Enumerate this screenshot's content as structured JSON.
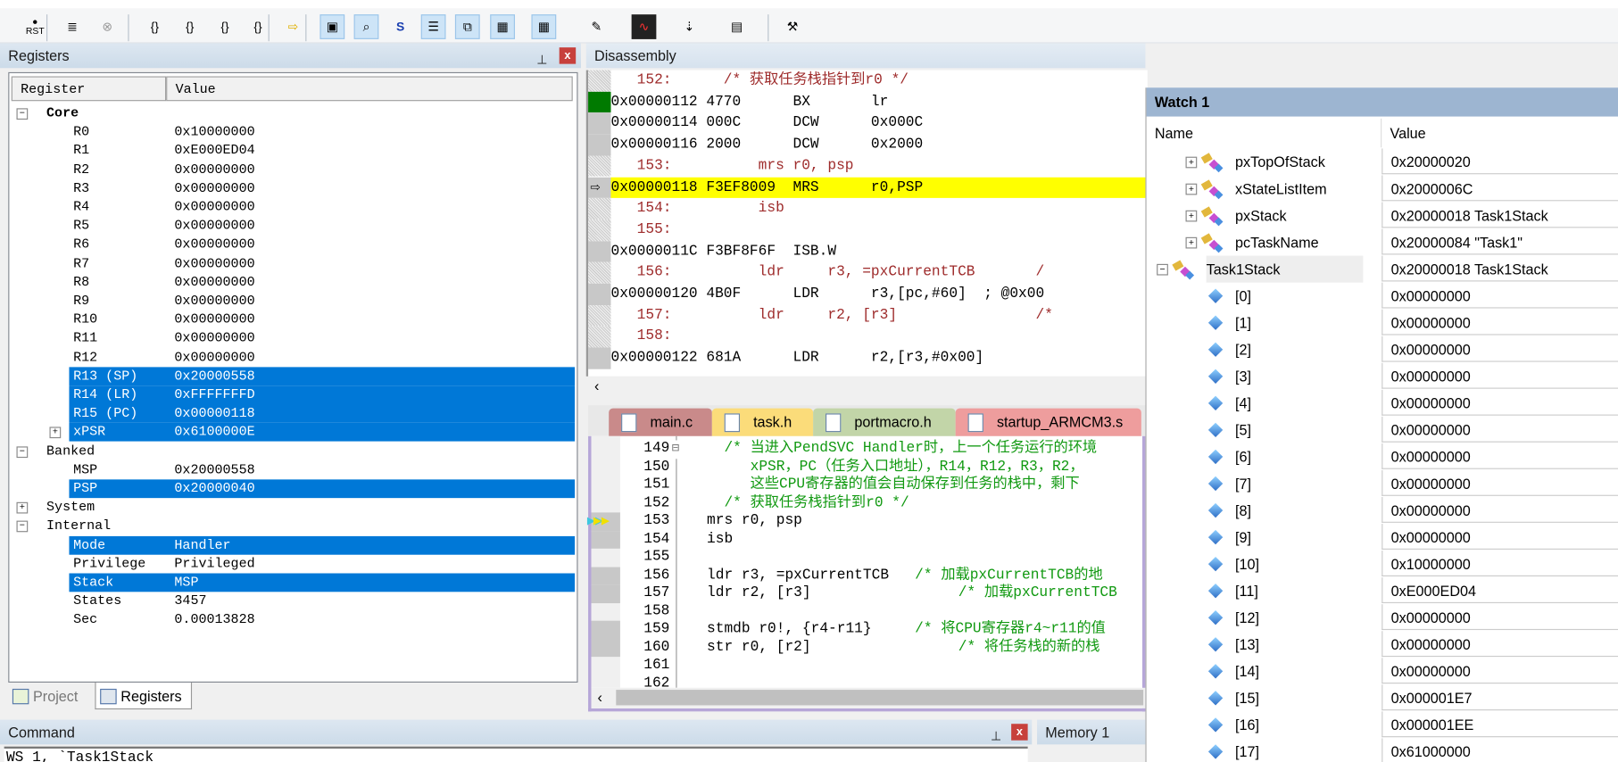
{
  "toolbar": {
    "buttons": [
      "reset-icon",
      "run-icon",
      "stop-icon",
      "step-into-icon",
      "step-over-icon",
      "step-out-icon",
      "run-to-cursor-icon",
      "show-next-statement-icon",
      "command-window-icon",
      "disassembly-window-icon",
      "symbols-window-icon",
      "registers-window-icon",
      "call-stack-icon",
      "watch-window-icon",
      "memory-window-icon",
      "serial-window-icon",
      "analysis-window-icon",
      "trace-icon",
      "system-viewer-icon",
      "toolbox-icon"
    ],
    "reset_label": "RST"
  },
  "registers": {
    "title": "Registers",
    "col_register": "Register",
    "col_value": "Value",
    "rows": [
      {
        "name": "Core",
        "value": "",
        "level": 0,
        "expander": "−",
        "bold": true
      },
      {
        "name": "R0",
        "value": "0x10000000",
        "level": 1
      },
      {
        "name": "R1",
        "value": "0xE000ED04",
        "level": 1
      },
      {
        "name": "R2",
        "value": "0x00000000",
        "level": 1
      },
      {
        "name": "R3",
        "value": "0x00000000",
        "level": 1
      },
      {
        "name": "R4",
        "value": "0x00000000",
        "level": 1
      },
      {
        "name": "R5",
        "value": "0x00000000",
        "level": 1
      },
      {
        "name": "R6",
        "value": "0x00000000",
        "level": 1
      },
      {
        "name": "R7",
        "value": "0x00000000",
        "level": 1
      },
      {
        "name": "R8",
        "value": "0x00000000",
        "level": 1
      },
      {
        "name": "R9",
        "value": "0x00000000",
        "level": 1
      },
      {
        "name": "R10",
        "value": "0x00000000",
        "level": 1
      },
      {
        "name": "R11",
        "value": "0x00000000",
        "level": 1
      },
      {
        "name": "R12",
        "value": "0x00000000",
        "level": 1
      },
      {
        "name": "R13 (SP)",
        "value": "0x20000558",
        "level": 1,
        "selected": true
      },
      {
        "name": "R14 (LR)",
        "value": "0xFFFFFFFD",
        "level": 1,
        "selected": true
      },
      {
        "name": "R15 (PC)",
        "value": "0x00000118",
        "level": 1,
        "selected": true
      },
      {
        "name": "xPSR",
        "value": "0x6100000E",
        "level": 1,
        "selected": true,
        "expander": "+"
      },
      {
        "name": "Banked",
        "value": "",
        "level": 0,
        "expander": "−"
      },
      {
        "name": "MSP",
        "value": "0x20000558",
        "level": 1
      },
      {
        "name": "PSP",
        "value": "0x20000040",
        "level": 1,
        "selected": true
      },
      {
        "name": "System",
        "value": "",
        "level": 0,
        "expander": "+"
      },
      {
        "name": "Internal",
        "value": "",
        "level": 0,
        "expander": "−"
      },
      {
        "name": "Mode",
        "value": "Handler",
        "level": 1,
        "selected": true
      },
      {
        "name": "Privilege",
        "value": "Privileged",
        "level": 1
      },
      {
        "name": "Stack",
        "value": "MSP",
        "level": 1,
        "selected": true
      },
      {
        "name": "States",
        "value": "3457",
        "level": 1
      },
      {
        "name": "Sec",
        "value": "0.00013828",
        "level": 1
      }
    ],
    "tabs": [
      {
        "label": "Project",
        "active": false
      },
      {
        "label": "Registers",
        "active": true
      }
    ]
  },
  "disassembly": {
    "title": "Disassembly",
    "rows": [
      {
        "type": "src",
        "text": "   152:      /* 获取任务栈指针到r0 */"
      },
      {
        "type": "asm",
        "text": "0x00000112 4770      BX       lr",
        "marker": "green"
      },
      {
        "type": "asm",
        "text": "0x00000114 000C      DCW      0x000C"
      },
      {
        "type": "asm",
        "text": "0x00000116 2000      DCW      0x2000"
      },
      {
        "type": "src",
        "text": "   153:          mrs r0, psp"
      },
      {
        "type": "asm",
        "text": "0x00000118 F3EF8009  MRS      r0,PSP",
        "current": true
      },
      {
        "type": "src",
        "text": "   154:          isb"
      },
      {
        "type": "src",
        "text": "   155:"
      },
      {
        "type": "asm",
        "text": "0x0000011C F3BF8F6F  ISB.W"
      },
      {
        "type": "src",
        "text": "   156:          ldr     r3, =pxCurrentTCB       /"
      },
      {
        "type": "asm",
        "text": "0x00000120 4B0F      LDR      r3,[pc,#60]  ; @0x00"
      },
      {
        "type": "src",
        "text": "   157:          ldr     r2, [r3]                /*"
      },
      {
        "type": "src",
        "text": "   158:"
      },
      {
        "type": "asm",
        "text": "0x00000122 681A      LDR      r2,[r3,#0x00]"
      }
    ]
  },
  "editor": {
    "tabs": [
      {
        "label": "main.c",
        "color": "#c98a8a"
      },
      {
        "label": "task.h",
        "color": "#fbdc7a"
      },
      {
        "label": "portmacro.h",
        "color": "#c2d5a8"
      },
      {
        "label": "startup_ARMCM3.s",
        "color": "#ee9d9d"
      }
    ],
    "lines": [
      {
        "no": "149",
        "code": "",
        "comment": "  /* 当进入PendSVC Handler时，上一个任务运行的环境",
        "fold": "⊟"
      },
      {
        "no": "150",
        "code": "",
        "comment": "     xPSR，PC（任务入口地址），R14，R12，R3，R2，"
      },
      {
        "no": "151",
        "code": "",
        "comment": "     这些CPU寄存器的值会自动保存到任务的栈中，剩下"
      },
      {
        "no": "152",
        "code": "",
        "comment": "  /* 获取任务栈指针到r0 */"
      },
      {
        "no": "153",
        "code": "mrs r0, psp",
        "comment": "",
        "current": true
      },
      {
        "no": "154",
        "code": "isb",
        "comment": ""
      },
      {
        "no": "155",
        "code": "",
        "comment": ""
      },
      {
        "no": "156",
        "code": "ldr r3, =pxCurrentTCB   ",
        "comment": "/* 加载pxCurrentTCB的地"
      },
      {
        "no": "157",
        "code": "ldr r2, [r3]            ",
        "comment": "     /* 加载pxCurrentTCB"
      },
      {
        "no": "158",
        "code": "",
        "comment": ""
      },
      {
        "no": "159",
        "code": "stmdb r0!, {r4-r11}     ",
        "comment": "/* 将CPU寄存器r4~r11的值"
      },
      {
        "no": "160",
        "code": "str r0, [r2]            ",
        "comment": "     /* 将任务栈的新的栈"
      },
      {
        "no": "161",
        "code": "",
        "comment": ""
      },
      {
        "no": "162",
        "code": "",
        "comment": ""
      }
    ]
  },
  "watch": {
    "title": "Watch 1",
    "col_name": "Name",
    "col_value": "Value",
    "rows": [
      {
        "name": "pxTopOfStack",
        "value": "0x20000020",
        "kind": "struct",
        "level": 1,
        "expander": "+"
      },
      {
        "name": "xStateListItem",
        "value": "0x2000006C",
        "kind": "struct",
        "level": 1,
        "expander": "+"
      },
      {
        "name": "pxStack",
        "value": "0x20000018 Task1Stack",
        "kind": "struct",
        "level": 1,
        "expander": "+"
      },
      {
        "name": "pcTaskName",
        "value": "0x20000084 \"Task1\"",
        "kind": "struct",
        "level": 1,
        "expander": "+"
      },
      {
        "name": "Task1Stack",
        "value": "0x20000018 Task1Stack",
        "kind": "struct",
        "level": 0,
        "expander": "−",
        "selected": true
      },
      {
        "name": "[0]",
        "value": "0x00000000",
        "kind": "var",
        "level": 1
      },
      {
        "name": "[1]",
        "value": "0x00000000",
        "kind": "var",
        "level": 1
      },
      {
        "name": "[2]",
        "value": "0x00000000",
        "kind": "var",
        "level": 1
      },
      {
        "name": "[3]",
        "value": "0x00000000",
        "kind": "var",
        "level": 1
      },
      {
        "name": "[4]",
        "value": "0x00000000",
        "kind": "var",
        "level": 1
      },
      {
        "name": "[5]",
        "value": "0x00000000",
        "kind": "var",
        "level": 1
      },
      {
        "name": "[6]",
        "value": "0x00000000",
        "kind": "var",
        "level": 1
      },
      {
        "name": "[7]",
        "value": "0x00000000",
        "kind": "var",
        "level": 1
      },
      {
        "name": "[8]",
        "value": "0x00000000",
        "kind": "var",
        "level": 1
      },
      {
        "name": "[9]",
        "value": "0x00000000",
        "kind": "var",
        "level": 1
      },
      {
        "name": "[10]",
        "value": "0x10000000",
        "kind": "var",
        "level": 1
      },
      {
        "name": "[11]",
        "value": "0xE000ED04",
        "kind": "var",
        "level": 1
      },
      {
        "name": "[12]",
        "value": "0x00000000",
        "kind": "var",
        "level": 1
      },
      {
        "name": "[13]",
        "value": "0x00000000",
        "kind": "var",
        "level": 1
      },
      {
        "name": "[14]",
        "value": "0x00000000",
        "kind": "var",
        "level": 1
      },
      {
        "name": "[15]",
        "value": "0x000001E7",
        "kind": "var",
        "level": 1
      },
      {
        "name": "[16]",
        "value": "0x000001EE",
        "kind": "var",
        "level": 1
      },
      {
        "name": "[17]",
        "value": "0x61000000",
        "kind": "var",
        "level": 1
      }
    ]
  },
  "command": {
    "title": "Command",
    "text": "WS 1, `Task1Stack"
  },
  "memory": {
    "title": "Memory 1"
  },
  "colors": {
    "selection": "#0078d7",
    "current_line": "#ffff00",
    "comment": "#119911",
    "source": "#9e2b2b",
    "panel_header": "#ccdbe9",
    "watch_header": "#9db5d1"
  }
}
